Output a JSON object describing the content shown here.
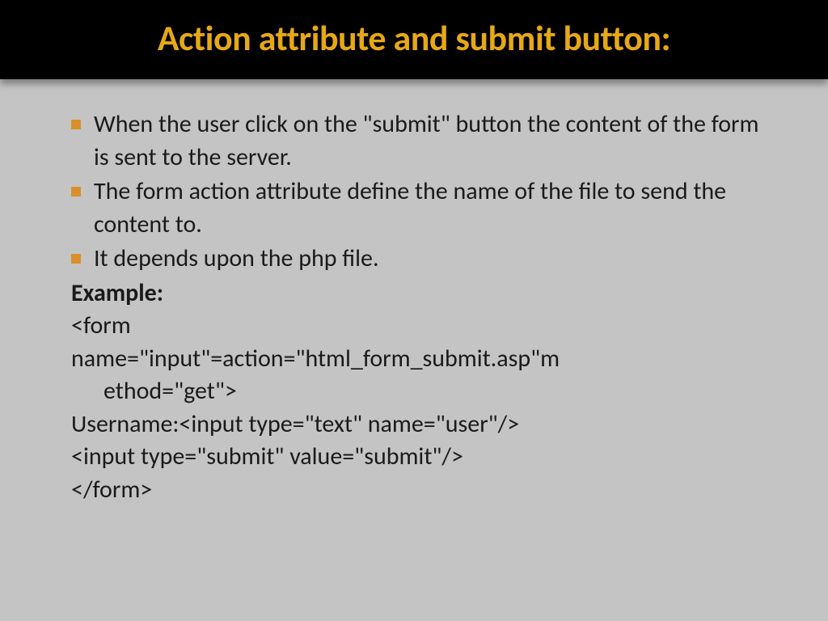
{
  "title": "Action attribute and submit button:",
  "bullets": [
    "When the user click on the \"submit\"  button the content of the form is sent to the server.",
    "The form action attribute define the name of the file  to send the content to.",
    "It depends upon the php file."
  ],
  "example_label": "Example:",
  "code": {
    "line1": "<form",
    "line2a": "name=\"input\"=action=\"html_form_submit.asp\"m",
    "line2b": "ethod=\"get\">",
    "line3": "Username:<input type=\"text\" name=\"user\"/>",
    "line4": "<input type=\"submit\" value=\"submit\"/>",
    "line5": "</form>"
  }
}
